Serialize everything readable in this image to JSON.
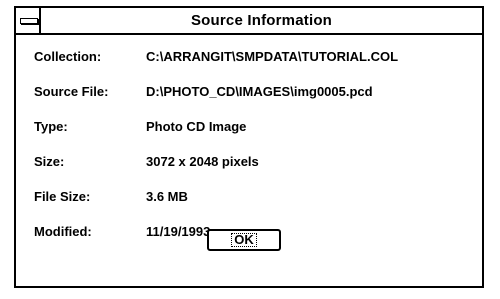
{
  "window": {
    "title": "Source Information",
    "system_menu_icon": "system-menu-icon"
  },
  "fields": [
    {
      "label": "Collection:",
      "value": "C:\\ARRANGIT\\SMPDATA\\TUTORIAL.COL"
    },
    {
      "label": "Source File:",
      "value": "D:\\PHOTO_CD\\IMAGES\\img0005.pcd"
    },
    {
      "label": "Type:",
      "value": "Photo CD Image"
    },
    {
      "label": "Size:",
      "value": "3072 x 2048 pixels"
    },
    {
      "label": "File Size:",
      "value": "3.6 MB"
    },
    {
      "label": "Modified:",
      "value": "11/19/1993"
    }
  ],
  "buttons": {
    "ok_label": "OK"
  }
}
